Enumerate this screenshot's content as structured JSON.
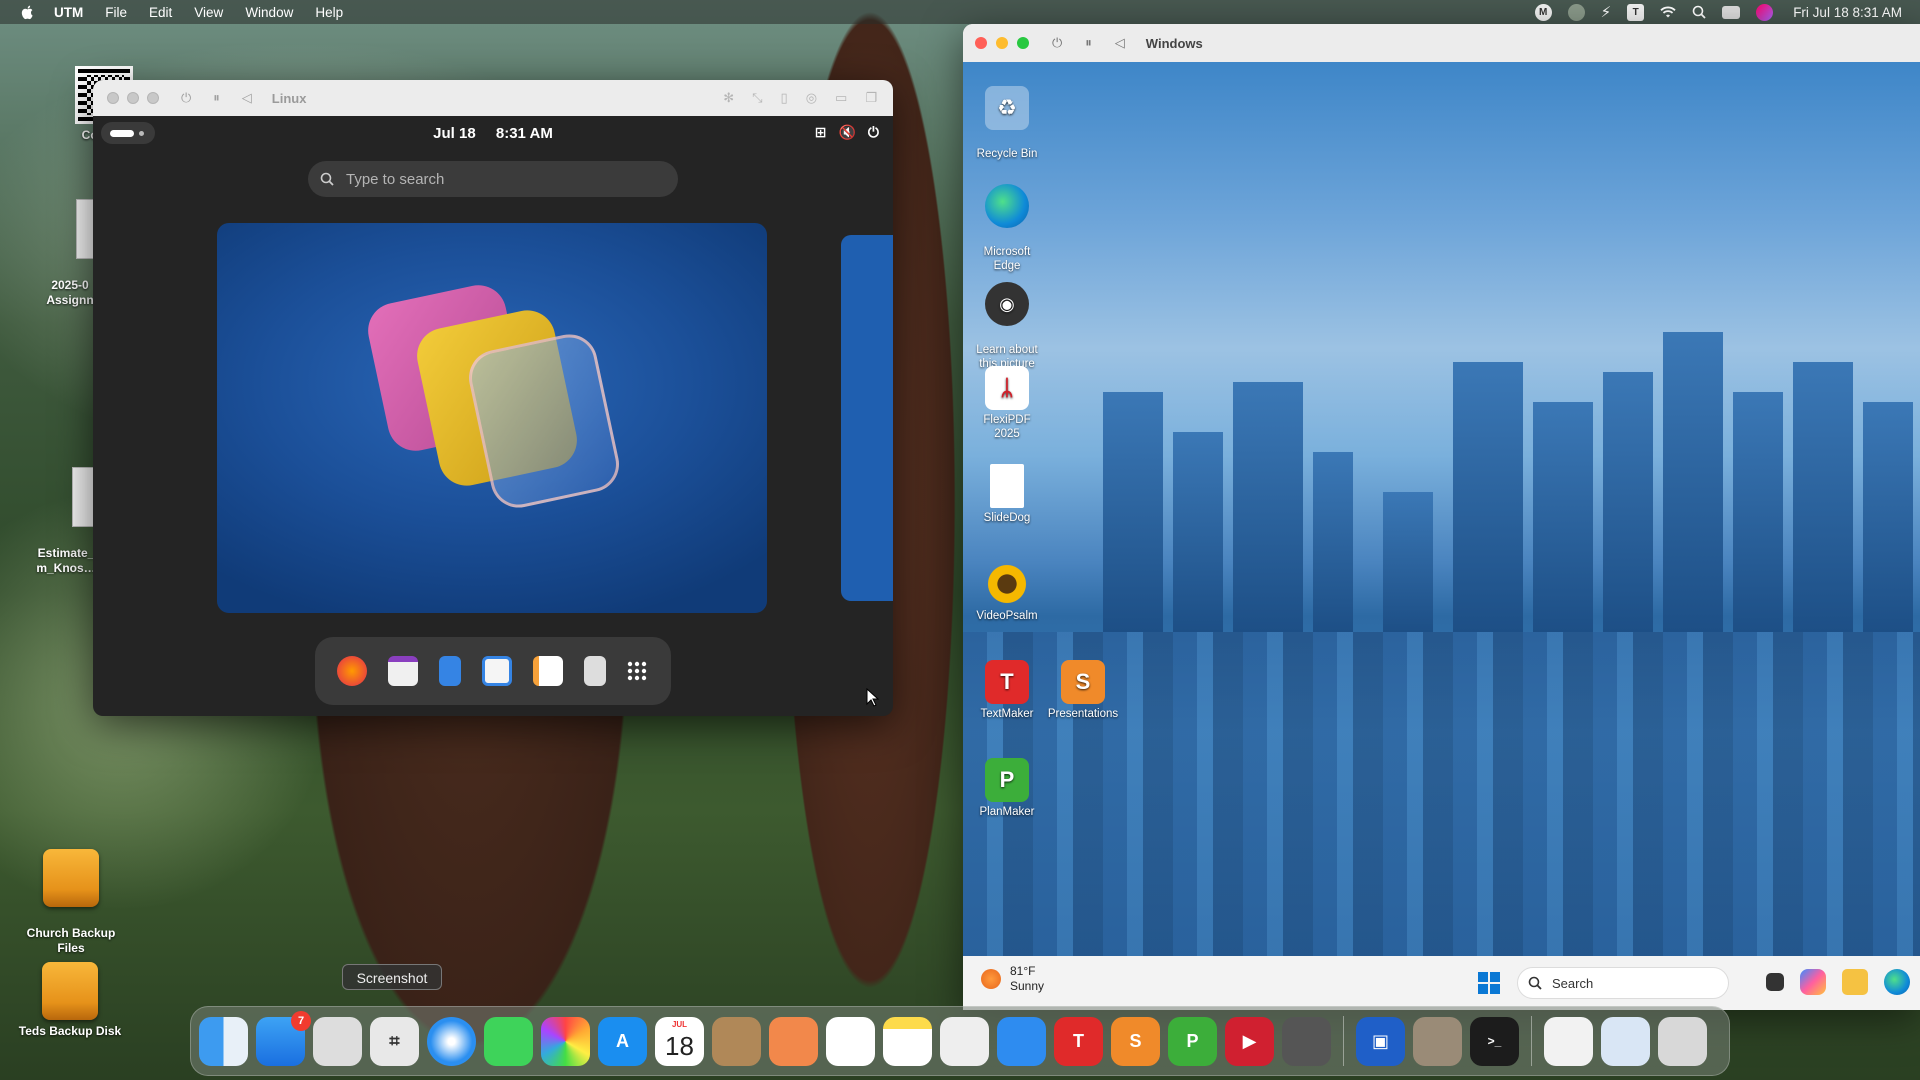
{
  "menubar": {
    "app_name": "UTM",
    "items": [
      "File",
      "Edit",
      "View",
      "Window",
      "Help"
    ],
    "clock": "Fri Jul 18  8:31 AM"
  },
  "desktop_icons": {
    "contact": "Contact",
    "assign": "2025-0\nAssignn",
    "estimate": "Estimate_\nm_Knos…",
    "church": "Church Backup\nFiles",
    "teds": "Teds Backup Disk"
  },
  "linux_window": {
    "title": "Linux",
    "date": "Jul 18",
    "time": "8:31 AM",
    "search_placeholder": "Type to search"
  },
  "windows_window": {
    "title": "Windows",
    "icons": {
      "recycle": "Recycle Bin",
      "edge": "Microsoft\nEdge",
      "learn": "Learn about\nthis picture",
      "flexipdf": "FlexiPDF 2025",
      "slidedog": "SlideDog",
      "videopsalm": "VideoPsalm",
      "textmaker": "TextMaker",
      "presentations": "Presentations",
      "planmaker": "PlanMaker"
    },
    "taskbar": {
      "temp": "81°F",
      "condition": "Sunny",
      "search_label": "Search"
    }
  },
  "dock": {
    "tooltip": "Screenshot",
    "mail_badge": "7",
    "calendar_month": "JUL",
    "calendar_day": "18"
  },
  "colors": {
    "accent_blue": "#0a78d4",
    "dock_badge": "#f23b2f",
    "traffic_red": "#ff5f57",
    "traffic_yellow": "#febc2e",
    "traffic_green": "#28c840"
  }
}
